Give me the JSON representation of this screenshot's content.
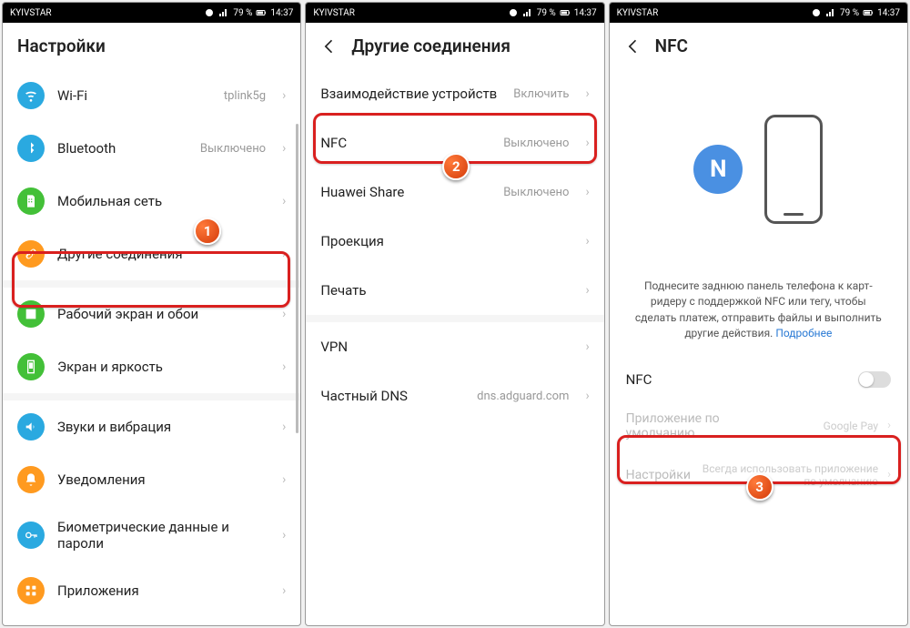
{
  "status": {
    "carrier": "KYIVSTAR",
    "battery": "79 %",
    "time": "14:37"
  },
  "screen1": {
    "title": "Настройки",
    "rows": [
      {
        "icon": "wifi",
        "bg": "#2aa9e0",
        "label": "Wi-Fi",
        "value": "tplink5g"
      },
      {
        "icon": "bt",
        "bg": "#2aa9e0",
        "label": "Bluetooth",
        "value": "Выключено"
      },
      {
        "icon": "sim",
        "bg": "#43c038",
        "label": "Мобильная сеть",
        "value": ""
      },
      {
        "icon": "link",
        "bg": "#ff9a1f",
        "label": "Другие соединения",
        "value": ""
      },
      {
        "icon": "image",
        "bg": "#43c038",
        "label": "Рабочий экран и обои",
        "value": ""
      },
      {
        "icon": "bright",
        "bg": "#43c038",
        "label": "Экран и яркость",
        "value": ""
      },
      {
        "icon": "sound",
        "bg": "#2aa9e0",
        "label": "Звуки и вибрация",
        "value": ""
      },
      {
        "icon": "bell",
        "bg": "#ff9a1f",
        "label": "Уведомления",
        "value": ""
      },
      {
        "icon": "key",
        "bg": "#2aa9e0",
        "label": "Биометрические данные и пароли",
        "value": ""
      },
      {
        "icon": "apps",
        "bg": "#ff9a1f",
        "label": "Приложения",
        "value": ""
      }
    ]
  },
  "screen2": {
    "title": "Другие соединения",
    "rows": [
      {
        "label": "Взаимодействие устройств",
        "value": "Включить"
      },
      {
        "label": "NFC",
        "value": "Выключено"
      },
      {
        "label": "Huawei Share",
        "value": "Выключено"
      },
      {
        "label": "Проекция",
        "value": ""
      },
      {
        "label": "Печать",
        "value": ""
      },
      {
        "label": "VPN",
        "value": ""
      },
      {
        "label": "Частный DNS",
        "value": "dns.adguard.com"
      }
    ]
  },
  "screen3": {
    "title": "NFC",
    "desc": "Поднесите заднюю панель телефона к карт-ридеру с поддержкой NFC или тегу, чтобы сделать платеж, отправить файлы и выполнить другие действия.",
    "more": "Подробнее",
    "toggle_label": "NFC",
    "opt1_label": "Приложение по умолчанию",
    "opt1_value": "Google Pay",
    "opt2_label": "Настройки",
    "opt2_value": "Всегда использовать приложение по умолчанию"
  },
  "badges": {
    "b1": "1",
    "b2": "2",
    "b3": "3"
  }
}
